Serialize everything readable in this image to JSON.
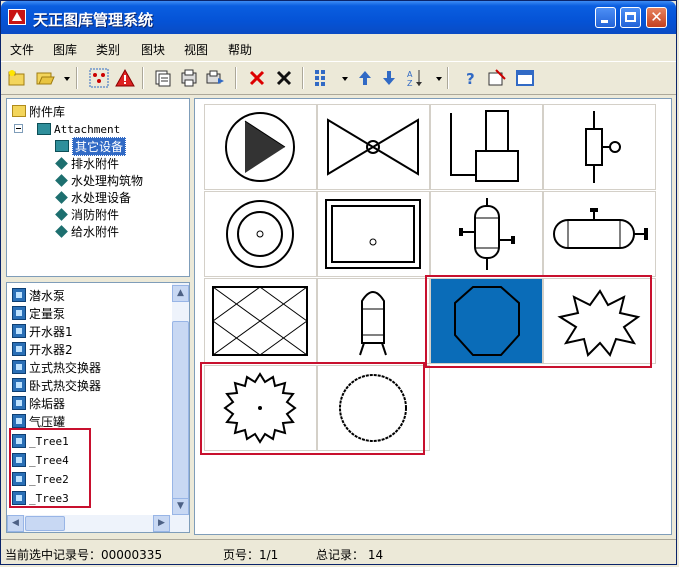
{
  "window": {
    "title": "天正图库管理系统"
  },
  "menu": [
    "文件",
    "图库",
    "类别",
    "图块",
    "视图",
    "帮助"
  ],
  "toolbar": {
    "icons": [
      "new-folder-icon",
      "open-folder-icon",
      "dropdown-icon",
      "select-icon",
      "warning-icon",
      "copy-icon",
      "export-icon",
      "import-icon",
      "delete-red-icon",
      "delete-black-icon",
      "grid-view-icon",
      "dropdown-icon",
      "move-up-icon",
      "move-down-icon",
      "sort-icon",
      "dropdown-icon",
      "help-icon",
      "settings-icon",
      "window-icon"
    ]
  },
  "tree": {
    "root": "附件库",
    "node": "Attachment",
    "children": [
      "其它设备",
      "排水附件",
      "水处理构筑物",
      "水处理设备",
      "消防附件",
      "给水附件"
    ],
    "selected_index": 0
  },
  "list": {
    "items": [
      "潜水泵",
      "定量泵",
      "开水器1",
      "开水器2",
      "立式热交换器",
      "卧式热交换器",
      "除垢器",
      "气压罐",
      "_Tree1",
      "_Tree4",
      "_Tree2",
      "_Tree3"
    ]
  },
  "grid": {
    "items": [
      "circle-pump",
      "butterfly-valve",
      "tall-tank",
      "side-valve",
      "concentric-circles",
      "rectangle-basin",
      "vertical-vessel",
      "horizontal-vessel",
      "cross-hatched-tank",
      "capsule-tank",
      "octagon",
      "starburst",
      "gear-circle",
      "wavy-circle"
    ],
    "selected_index": 10
  },
  "status": {
    "record_label": "当前选中记录号：00000335",
    "page_label": "页号：1/1",
    "total_label": "总记录： 14"
  }
}
